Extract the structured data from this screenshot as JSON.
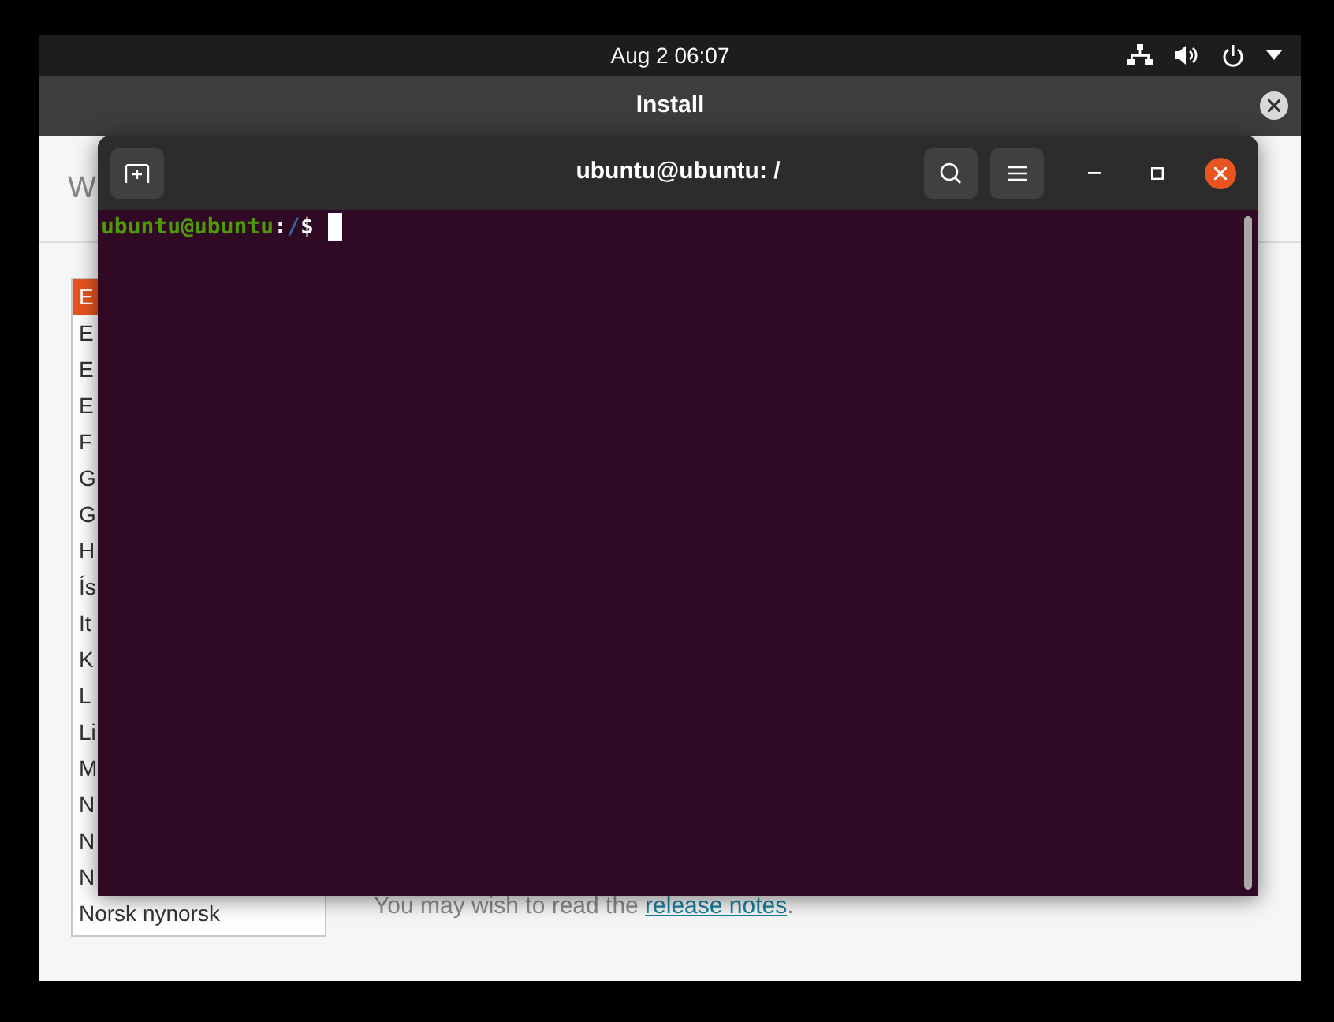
{
  "top_bar": {
    "clock": "Aug 2  06:07"
  },
  "installer": {
    "title": "Install",
    "heading": "W",
    "languages": [
      {
        "label": "E",
        "selected": true
      },
      {
        "label": "E",
        "selected": false
      },
      {
        "label": "E",
        "selected": false
      },
      {
        "label": "E",
        "selected": false
      },
      {
        "label": "F",
        "selected": false
      },
      {
        "label": "G",
        "selected": false
      },
      {
        "label": "G",
        "selected": false
      },
      {
        "label": "H",
        "selected": false
      },
      {
        "label": "Ís",
        "selected": false
      },
      {
        "label": "It",
        "selected": false
      },
      {
        "label": "K",
        "selected": false
      },
      {
        "label": "L",
        "selected": false
      },
      {
        "label": "Li",
        "selected": false
      },
      {
        "label": "M",
        "selected": false
      },
      {
        "label": "N",
        "selected": false
      },
      {
        "label": "N",
        "selected": false
      },
      {
        "label": "N",
        "selected": false
      },
      {
        "label": "Norsk nynorsk",
        "selected": false
      }
    ],
    "note": {
      "text": "You may wish to read the ",
      "link": "release notes",
      "after": "."
    }
  },
  "terminal": {
    "title": "ubuntu@ubuntu: /",
    "prompt": {
      "user_host": "ubuntu@ubuntu",
      "separator": ":",
      "path": "/",
      "symbol": "$"
    }
  }
}
